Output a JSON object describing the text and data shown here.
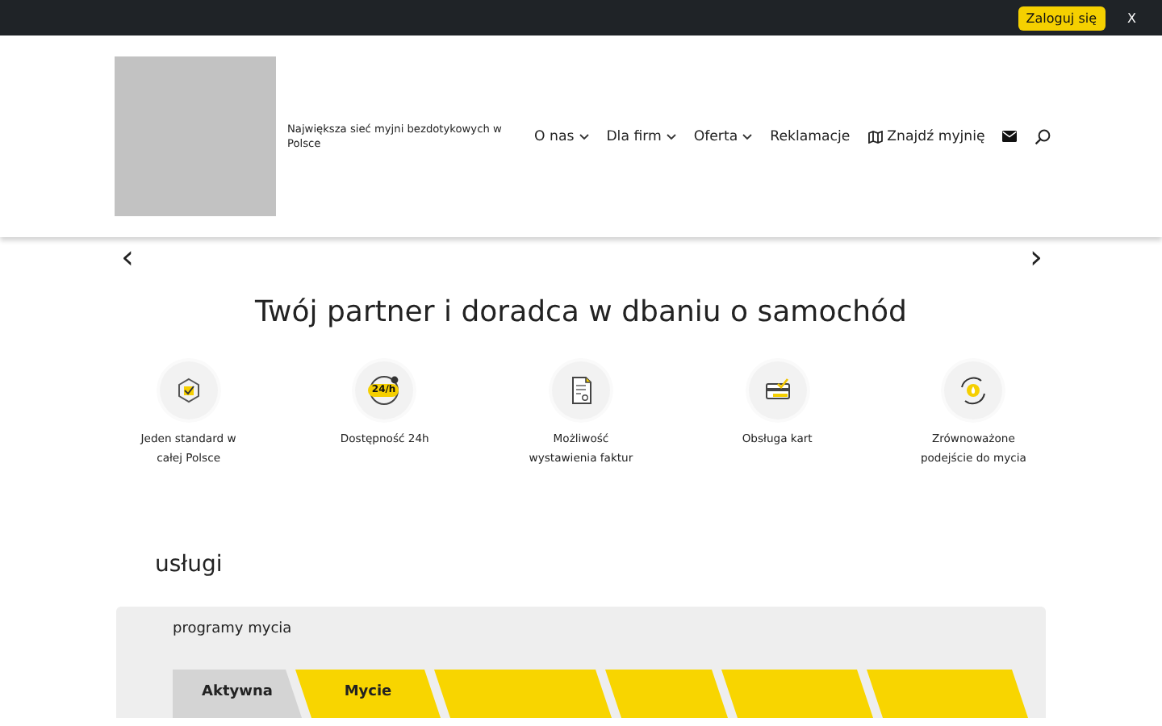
{
  "top_bar": {
    "login_button": "Zaloguj się",
    "close": "X"
  },
  "header": {
    "tagline": "Największa sieć myjni bezdotykowych w Polsce",
    "nav": [
      {
        "label": "O nas",
        "kind": "dropdown"
      },
      {
        "label": "Dla firm",
        "kind": "dropdown"
      },
      {
        "label": "Oferta",
        "kind": "dropdown"
      },
      {
        "label": "Reklamacje",
        "kind": "link"
      },
      {
        "label": "Znajdź myjnię",
        "kind": "map"
      },
      {
        "kind": "mail"
      },
      {
        "kind": "search"
      }
    ]
  },
  "slider": {
    "prev": "‹",
    "next": "›",
    "heading": "Twój partner i doradca w dbaniu o samochód"
  },
  "features": [
    {
      "label": "Jeden standard w całej Polsce"
    },
    {
      "icon_text": "24/h",
      "label": "Dostępność 24h"
    },
    {
      "label": "Możliwość wystawienia faktur"
    },
    {
      "label": "Obsługa kart"
    },
    {
      "label": "Zrównoważone podejście do mycia"
    }
  ],
  "services": {
    "title": "usługi",
    "panel_title": "programy mycia",
    "tabs": [
      {
        "label": "Aktywna",
        "selected": true
      },
      {
        "label": "Mycie",
        "selected": false
      },
      {
        "selected": false
      },
      {
        "selected": false
      },
      {
        "selected": false
      },
      {
        "selected": false
      }
    ]
  }
}
